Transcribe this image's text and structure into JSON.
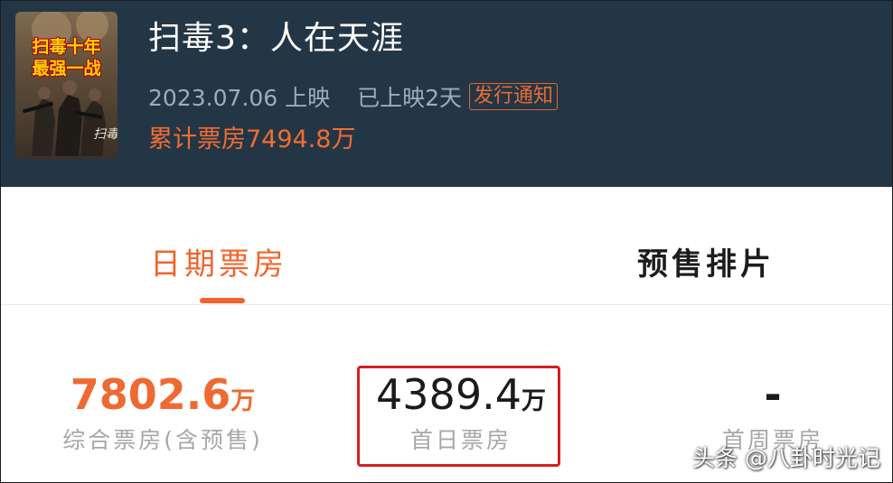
{
  "movie": {
    "title": "扫毒3：人在天涯",
    "release_date": "2023.07.06 上映",
    "days_released": "已上映2天",
    "release_tag": "发行通知",
    "cumulative_box_office": "累计票房7494.8万",
    "poster": {
      "line1": "扫毒十年",
      "line2": "最强一战"
    }
  },
  "tabs": [
    {
      "label": "日期票房",
      "active": true
    },
    {
      "label": "预售排片",
      "active": false
    }
  ],
  "stats": [
    {
      "value": "7802.6",
      "unit": "万",
      "label": "综合票房(含预售)"
    },
    {
      "value": "4389.4",
      "unit": "万",
      "label": "首日票房"
    },
    {
      "value": "-",
      "unit": "",
      "label": "首周票房"
    }
  ],
  "watermark": "头条 @八卦时光记",
  "colors": {
    "header_bg": "#233645",
    "accent": "#f1642b",
    "highlight_box": "#d61f1f"
  }
}
